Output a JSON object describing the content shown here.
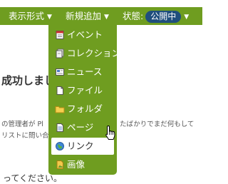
{
  "toolbar": {
    "display_menu": "表示形式",
    "add_menu": "新規追加",
    "state_label": "状態:",
    "state_value": "公開中",
    "caret": "▼"
  },
  "background": {
    "heading": "成功しまし",
    "line1_left": "の管理者が Pl",
    "line1_right": "たばかりでまだ何もして",
    "line2": "リストに問い合",
    "bottom_text": "ってください。"
  },
  "add_menu": {
    "items": [
      {
        "label": "イベント",
        "icon": "event-icon"
      },
      {
        "label": "コレクション",
        "icon": "collection-icon"
      },
      {
        "label": "ニュース",
        "icon": "news-icon"
      },
      {
        "label": "ファイル",
        "icon": "file-icon"
      },
      {
        "label": "フォルダ",
        "icon": "folder-icon"
      },
      {
        "label": "ページ",
        "icon": "page-icon"
      },
      {
        "label": "リンク",
        "icon": "link-icon",
        "highlighted": true
      },
      {
        "label": "画像",
        "icon": "image-icon"
      }
    ]
  },
  "colors": {
    "toolbar_green": "#6f9d20",
    "state_pill": "#1f4e7d",
    "highlight_bg": "#ffffff"
  }
}
